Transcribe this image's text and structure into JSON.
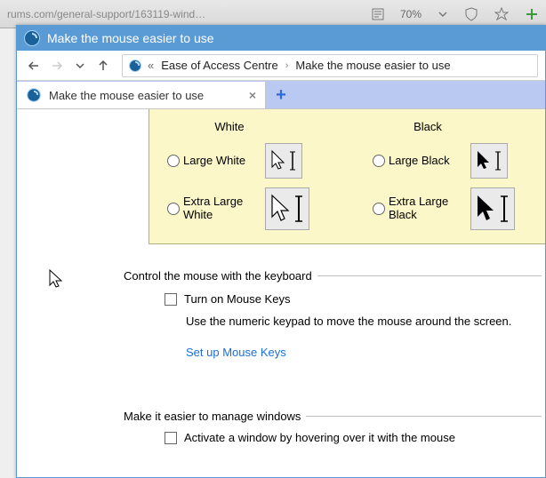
{
  "browser_bg": {
    "url_fragment": "rums.com/general-support/163119-wind…",
    "zoom": "70%"
  },
  "window": {
    "title": "Make the mouse easier to use"
  },
  "nav": {
    "crumb_root": "Ease of Access Centre",
    "crumb_leaf": "Make the mouse easier to use"
  },
  "tab": {
    "label": "Make the mouse easier to use"
  },
  "pointers": {
    "top_left": "White",
    "top_right": "Black",
    "mid_left": "Large White",
    "mid_right": "Large Black",
    "bot_left": "Extra Large White",
    "bot_right": "Extra Large Black"
  },
  "keyboard_section": {
    "legend": "Control the mouse with the keyboard",
    "checkbox": "Turn on Mouse Keys",
    "desc": "Use the numeric keypad to move the mouse around the screen.",
    "link": "Set up Mouse Keys"
  },
  "windows_section": {
    "legend": "Make it easier to manage windows",
    "checkbox": "Activate a window by hovering over it with the mouse"
  }
}
